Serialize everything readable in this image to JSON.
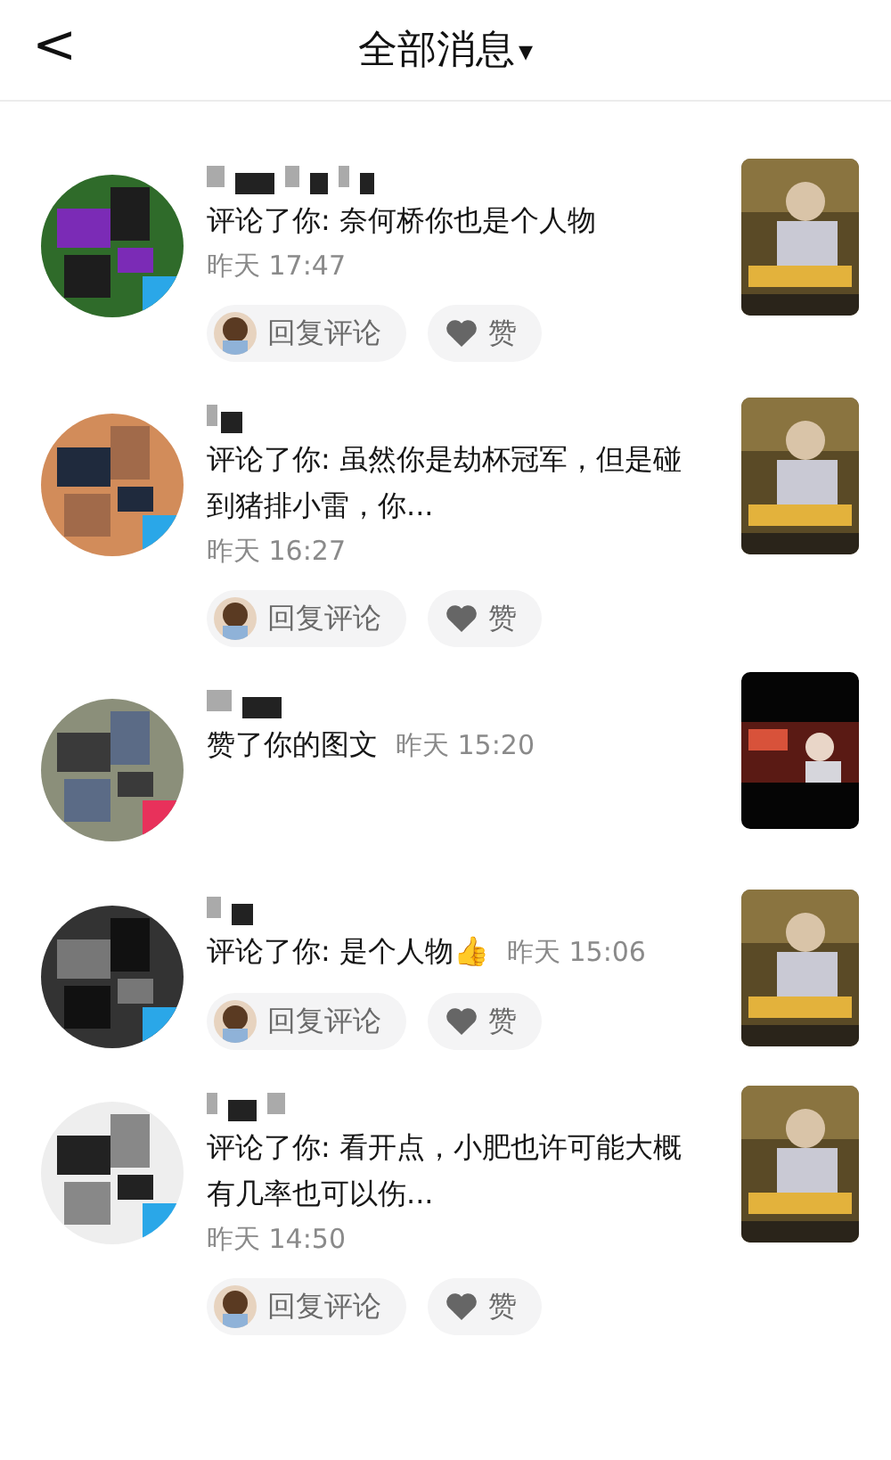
{
  "header": {
    "back": "<",
    "title": "全部消息",
    "dropdown": "▾"
  },
  "notifications": [
    {
      "kind": "comment",
      "message": "评论了你: 奈何桥你也是个人物",
      "time": "昨天 17:47",
      "time_below": true,
      "actions": {
        "reply": "回复评论",
        "like": "赞"
      }
    },
    {
      "kind": "comment",
      "message": "评论了你: 虽然你是劫杯冠军，但是碰到猪排小雷，你...",
      "time": "昨天 16:27",
      "time_below": true,
      "actions": {
        "reply": "回复评论",
        "like": "赞"
      }
    },
    {
      "kind": "like",
      "message": "赞了你的图文",
      "time": "昨天 15:20",
      "time_below": false
    },
    {
      "kind": "comment",
      "message": "评论了你: 是个人物👍",
      "time": "昨天 15:06",
      "time_below": false,
      "actions": {
        "reply": "回复评论",
        "like": "赞"
      }
    },
    {
      "kind": "comment",
      "message": "评论了你: 看开点，小肥也许可能大概有几率也可以伤...",
      "time": "昨天 14:50",
      "time_below": true,
      "actions": {
        "reply": "回复评论",
        "like": "赞"
      }
    }
  ]
}
